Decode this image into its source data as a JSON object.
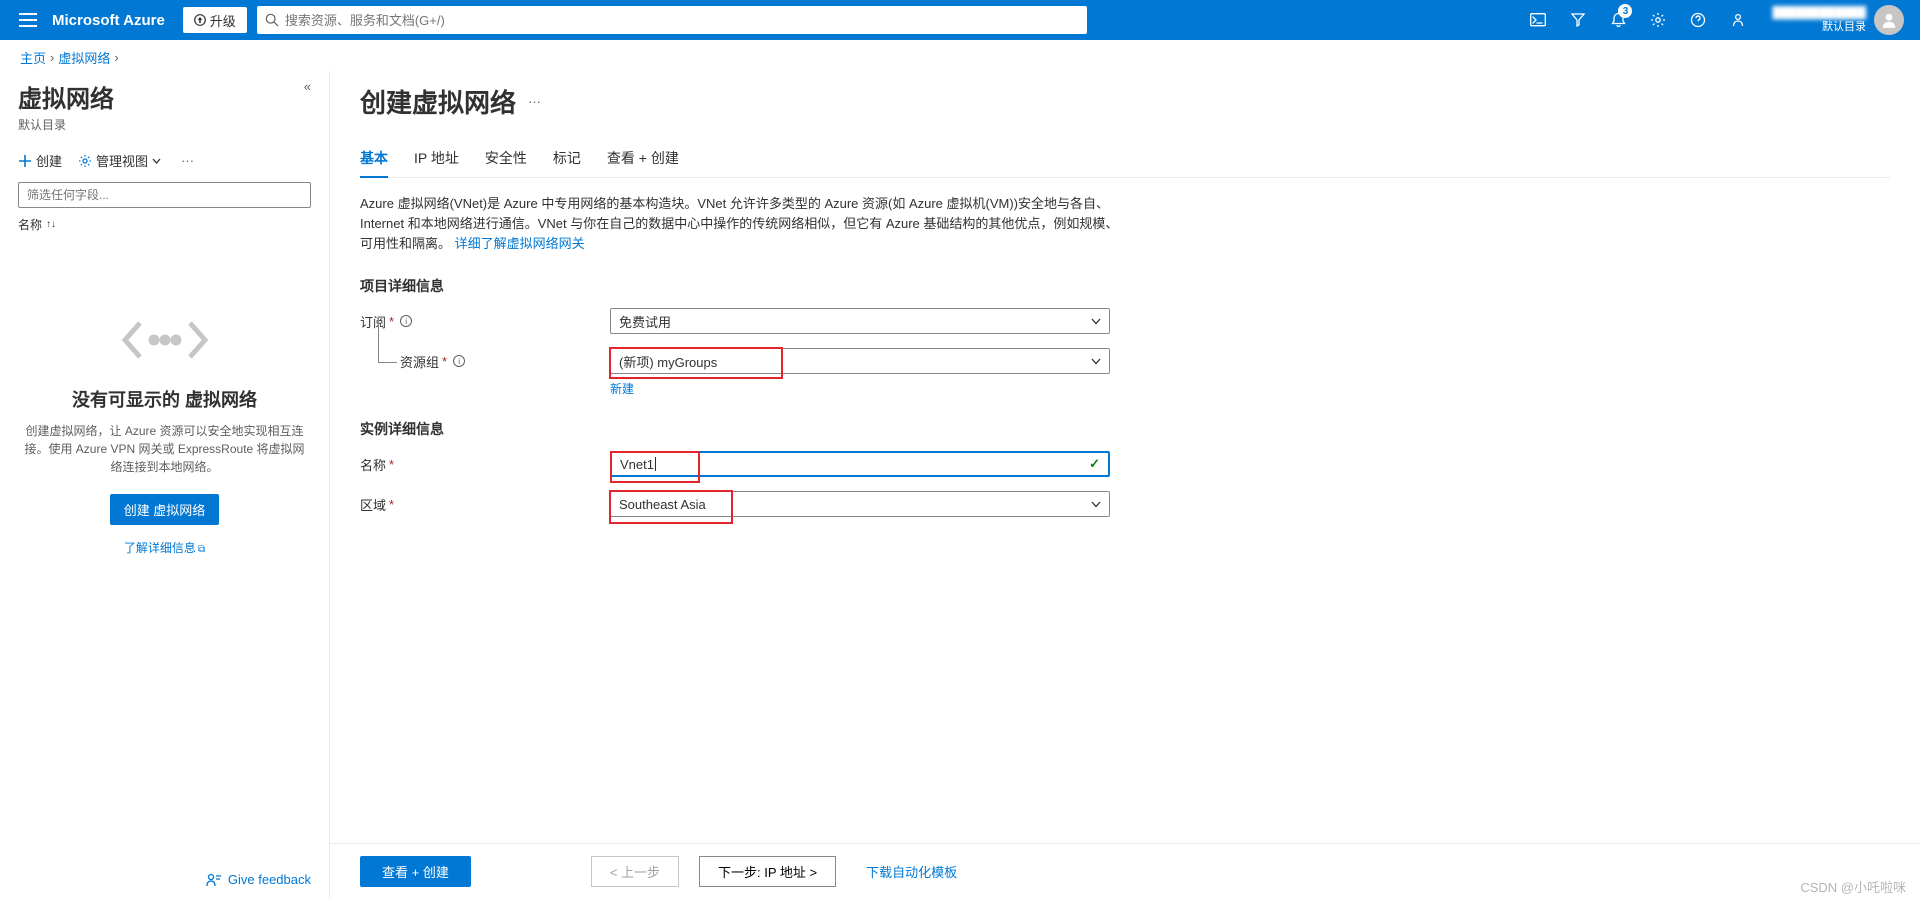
{
  "brand": "Microsoft Azure",
  "upgrade_label": "升级",
  "search_placeholder": "搜索资源、服务和文档(G+/)",
  "notification_count": "3",
  "user_line1": "████████████",
  "user_line2": "默认目录",
  "breadcrumb": {
    "home": "主页",
    "vnet": "虚拟网络"
  },
  "sidebar": {
    "title": "虚拟网络",
    "subtitle": "默认目录",
    "create": "创建",
    "manage_view": "管理视图",
    "filter_placeholder": "筛选任何字段...",
    "sort_label": "名称",
    "empty_title": "没有可显示的 虚拟网络",
    "empty_desc": "创建虚拟网络，让 Azure 资源可以安全地实现相互连接。使用 Azure VPN 网关或 ExpressRoute 将虚拟网络连接到本地网络。",
    "empty_cta": "创建 虚拟网络",
    "learn_more": "了解详细信息",
    "feedback": "Give feedback"
  },
  "main": {
    "title": "创建虚拟网络",
    "tabs": [
      "基本",
      "IP 地址",
      "安全性",
      "标记",
      "查看 + 创建"
    ],
    "desc": "Azure 虚拟网络(VNet)是 Azure 中专用网络的基本构造块。VNet 允许许多类型的 Azure 资源(如 Azure 虚拟机(VM))安全地与各自、Internet 和本地网络进行通信。VNet 与你在自己的数据中心中操作的传统网络相似，但它有 Azure 基础结构的其他优点，例如规模、可用性和隔离。 ",
    "desc_link": "详细了解虚拟网络网关",
    "section_project": "项目详细信息",
    "label_subscription": "订阅",
    "value_subscription": "免费试用",
    "label_resource_group": "资源组",
    "value_resource_group": "(新项) myGroups",
    "link_new": "新建",
    "section_instance": "实例详细信息",
    "label_name": "名称",
    "value_name": "Vnet1",
    "label_region": "区域",
    "value_region": "Southeast Asia"
  },
  "footer": {
    "review": "查看 + 创建",
    "prev": "< 上一步",
    "next": "下一步: IP 地址 >",
    "download": "下载自动化模板"
  },
  "watermark": "CSDN @小吒啦咪"
}
